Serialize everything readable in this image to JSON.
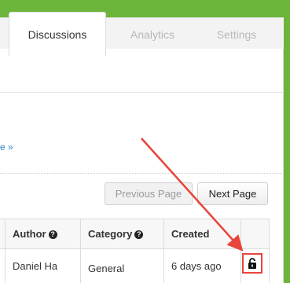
{
  "tabs": [
    {
      "label": "Discussions",
      "active": true
    },
    {
      "label": "Analytics",
      "active": false
    },
    {
      "label": "Settings",
      "active": false
    }
  ],
  "more_link": "e »",
  "pagination": {
    "previous": "Previous Page",
    "next": "Next Page"
  },
  "table": {
    "headers": {
      "author": "Author",
      "category": "Category",
      "created": "Created"
    },
    "help_glyph": "?",
    "rows": [
      {
        "author": "Daniel Ha",
        "category": "General",
        "created": "6 days ago"
      }
    ]
  },
  "colors": {
    "brand_green": "#6ab53a",
    "annotation_red": "#e8443a",
    "link_blue": "#2a86c8"
  },
  "icons": {
    "lock": "unlocked-padlock-icon"
  }
}
